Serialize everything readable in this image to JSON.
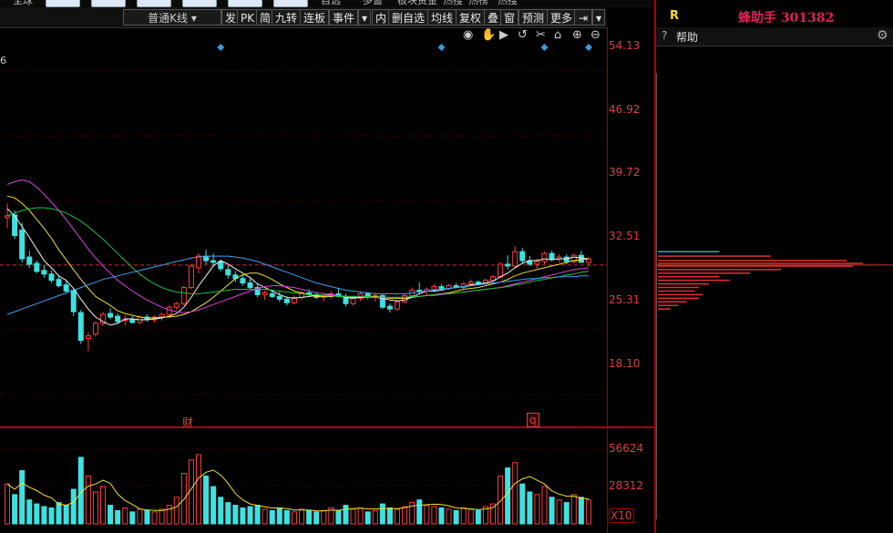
{
  "nav": {
    "items": [
      "全球",
      "自选",
      "多窗",
      "板块资金",
      "热搜",
      "热榜",
      "热搜"
    ]
  },
  "toolbar": {
    "kline_type": "普通K线",
    "buttons": [
      "发",
      "PK",
      "简",
      "九转",
      "连板",
      "事件",
      "内",
      "删自选",
      "均线",
      "复权",
      "叠",
      "窗",
      "预测",
      "更多"
    ]
  },
  "right_panel": {
    "label": "R",
    "title": "蜂助手 301382",
    "help_label": "帮助"
  },
  "left_edge_text": "6",
  "price_axis": {
    "ticks": [
      "54.13",
      "46.92",
      "39.72",
      "32.51",
      "25.31",
      "18.10"
    ]
  },
  "volume_axis": {
    "ticks": [
      "56624",
      "28312"
    ],
    "unit": "X10"
  },
  "markers": {
    "finance": "财",
    "q": "q"
  },
  "colors": {
    "up": "#ff3b3b",
    "down": "#3fe0e0",
    "ma5": "#f0f0f0",
    "ma10": "#f0e030",
    "ma20": "#e040e0",
    "ma30": "#20c040",
    "ma60": "#40a0f0",
    "event": "#3a9ad8",
    "axis": "#d84040"
  },
  "chart_data": {
    "type": "candlestick",
    "x": [
      "1",
      "2",
      "3",
      "4",
      "5",
      "6",
      "7",
      "8",
      "9",
      "10",
      "11",
      "12",
      "13",
      "14",
      "15",
      "16",
      "17",
      "18",
      "19",
      "20",
      "21",
      "22",
      "23",
      "24",
      "25",
      "26",
      "27",
      "28",
      "29",
      "30",
      "31",
      "32",
      "33",
      "34",
      "35",
      "36",
      "37",
      "38",
      "39",
      "40",
      "41",
      "42",
      "43",
      "44",
      "45",
      "46",
      "47",
      "48",
      "49",
      "50",
      "51",
      "52",
      "53",
      "54",
      "55",
      "56",
      "57",
      "58",
      "59",
      "60",
      "61",
      "62",
      "63",
      "64",
      "65",
      "66",
      "67",
      "68",
      "69",
      "70",
      "71",
      "72",
      "73",
      "74",
      "75",
      "76",
      "77",
      "78",
      "79",
      "80"
    ],
    "ohlc": [
      [
        37.8,
        39.4,
        36.6,
        38.0
      ],
      [
        38.1,
        38.6,
        35.4,
        35.8
      ],
      [
        36.4,
        37.2,
        32.8,
        33.2
      ],
      [
        33.4,
        34.1,
        32.2,
        32.6
      ],
      [
        32.7,
        33.0,
        31.6,
        31.8
      ],
      [
        31.9,
        32.5,
        31.1,
        31.5
      ],
      [
        31.5,
        31.9,
        30.5,
        30.8
      ],
      [
        30.9,
        31.4,
        30.0,
        30.2
      ],
      [
        30.3,
        30.7,
        29.3,
        29.6
      ],
      [
        29.7,
        29.9,
        26.8,
        27.3
      ],
      [
        27.2,
        27.5,
        23.7,
        24.1
      ],
      [
        24.3,
        25.0,
        22.9,
        24.6
      ],
      [
        24.8,
        26.2,
        24.5,
        26.0
      ],
      [
        26.0,
        27.3,
        25.7,
        27.0
      ],
      [
        27.1,
        27.7,
        26.5,
        26.7
      ],
      [
        26.8,
        27.1,
        26.0,
        26.2
      ],
      [
        26.3,
        26.9,
        25.8,
        26.4
      ],
      [
        26.4,
        26.8,
        26.0,
        26.1
      ],
      [
        26.1,
        26.9,
        25.9,
        26.7
      ],
      [
        26.7,
        27.0,
        26.2,
        26.4
      ],
      [
        26.4,
        26.9,
        26.1,
        26.7
      ],
      [
        26.7,
        27.2,
        26.3,
        27.0
      ],
      [
        27.0,
        28.0,
        26.8,
        27.8
      ],
      [
        27.8,
        28.4,
        27.5,
        28.2
      ],
      [
        28.2,
        30.2,
        28.0,
        30.0
      ],
      [
        30.0,
        32.6,
        29.8,
        32.4
      ],
      [
        32.2,
        33.8,
        31.6,
        33.5
      ],
      [
        33.5,
        34.2,
        32.6,
        33.0
      ],
      [
        33.0,
        33.8,
        32.4,
        32.8
      ],
      [
        32.9,
        33.1,
        31.8,
        32.1
      ],
      [
        32.0,
        32.5,
        31.0,
        31.4
      ],
      [
        31.4,
        31.8,
        30.6,
        31.0
      ],
      [
        31.0,
        31.4,
        30.2,
        30.5
      ],
      [
        30.5,
        31.0,
        29.8,
        30.0
      ],
      [
        30.0,
        30.5,
        28.9,
        29.2
      ],
      [
        29.2,
        29.7,
        28.6,
        29.4
      ],
      [
        29.3,
        29.8,
        28.8,
        29.0
      ],
      [
        29.0,
        29.5,
        28.4,
        28.7
      ],
      [
        28.7,
        29.0,
        28.0,
        28.3
      ],
      [
        28.3,
        29.1,
        28.1,
        28.9
      ],
      [
        28.9,
        29.6,
        28.6,
        29.4
      ],
      [
        29.4,
        29.8,
        29.0,
        29.2
      ],
      [
        29.2,
        29.5,
        28.7,
        28.9
      ],
      [
        28.9,
        29.4,
        28.5,
        29.0
      ],
      [
        29.0,
        29.6,
        28.8,
        29.3
      ],
      [
        29.3,
        29.9,
        28.9,
        29.0
      ],
      [
        29.0,
        29.3,
        27.9,
        28.2
      ],
      [
        28.2,
        29.0,
        28.0,
        28.8
      ],
      [
        28.8,
        29.6,
        28.5,
        29.3
      ],
      [
        29.3,
        29.5,
        28.7,
        28.9
      ],
      [
        28.9,
        29.4,
        28.4,
        29.1
      ],
      [
        29.1,
        29.3,
        27.6,
        27.8
      ],
      [
        27.9,
        28.2,
        27.2,
        27.6
      ],
      [
        27.6,
        28.6,
        27.4,
        28.4
      ],
      [
        28.4,
        29.3,
        28.2,
        29.1
      ],
      [
        29.1,
        30.0,
        28.9,
        29.7
      ],
      [
        29.7,
        30.6,
        29.3,
        29.6
      ],
      [
        29.6,
        30.0,
        29.1,
        29.8
      ],
      [
        29.8,
        30.4,
        29.5,
        30.1
      ],
      [
        30.1,
        30.4,
        29.7,
        29.9
      ],
      [
        29.9,
        30.4,
        29.7,
        30.2
      ],
      [
        30.2,
        30.5,
        29.9,
        30.0
      ],
      [
        30.0,
        30.6,
        29.8,
        30.4
      ],
      [
        30.4,
        30.9,
        30.2,
        30.6
      ],
      [
        30.6,
        30.8,
        30.2,
        30.5
      ],
      [
        30.5,
        31.0,
        30.3,
        30.8
      ],
      [
        30.8,
        31.4,
        30.6,
        31.2
      ],
      [
        31.2,
        32.8,
        31.0,
        32.6
      ],
      [
        32.6,
        33.6,
        32.0,
        32.4
      ],
      [
        32.4,
        34.6,
        32.2,
        34.0
      ],
      [
        34.0,
        34.4,
        32.7,
        33.0
      ],
      [
        33.0,
        33.5,
        32.4,
        32.6
      ],
      [
        32.6,
        33.2,
        32.1,
        32.9
      ],
      [
        32.9,
        34.0,
        32.6,
        33.8
      ],
      [
        33.8,
        34.1,
        32.9,
        33.2
      ],
      [
        33.2,
        33.7,
        32.8,
        33.4
      ],
      [
        33.4,
        33.7,
        32.6,
        32.9
      ],
      [
        32.9,
        33.8,
        32.7,
        33.6
      ],
      [
        33.6,
        34.1,
        32.8,
        32.8
      ],
      [
        32.8,
        33.4,
        32.4,
        33.2
      ]
    ],
    "volume": [
      30000,
      22000,
      40000,
      18000,
      15000,
      13000,
      12000,
      16000,
      14000,
      26000,
      50000,
      36000,
      24000,
      28000,
      14000,
      10000,
      12000,
      9000,
      11000,
      10000,
      9000,
      11000,
      14000,
      20000,
      38000,
      48000,
      52000,
      36000,
      28000,
      20000,
      16000,
      14000,
      12000,
      13000,
      14000,
      11000,
      10000,
      12000,
      10000,
      9000,
      11000,
      10000,
      9000,
      10000,
      12000,
      10000,
      14000,
      11000,
      12000,
      9000,
      10000,
      15000,
      12000,
      11000,
      13000,
      16000,
      18000,
      14000,
      13000,
      12000,
      11000,
      10000,
      12000,
      11000,
      10000,
      13000,
      15000,
      36000,
      42000,
      46000,
      30000,
      24000,
      22000,
      28000,
      20000,
      18000,
      16000,
      22000,
      20000,
      18000
    ],
    "ma_lines": [
      {
        "name": "MA5",
        "values": [
          38.8,
          38.0,
          36.8,
          35.6,
          34.3,
          33.0,
          32.2,
          31.3,
          30.8,
          29.9,
          28.7,
          27.6,
          26.7,
          26.2,
          25.8,
          26.0,
          26.5,
          26.5,
          26.4,
          26.4,
          26.5,
          26.6,
          26.8,
          27.1,
          27.8,
          28.9,
          30.2,
          31.3,
          32.4,
          33.0,
          32.6,
          32.1,
          31.6,
          31.1,
          30.4,
          30.0,
          29.6,
          29.2,
          28.9,
          28.8,
          28.9,
          29.0,
          29.1,
          29.1,
          29.2,
          29.1,
          28.9,
          28.8,
          28.9,
          28.9,
          28.9,
          28.8,
          28.6,
          28.5,
          28.6,
          28.9,
          29.3,
          29.6,
          29.6,
          29.7,
          29.9,
          30.0,
          30.1,
          30.3,
          30.4,
          30.5,
          30.7,
          31.2,
          31.6,
          32.2,
          32.7,
          33.0,
          33.0,
          33.2,
          33.1,
          33.2,
          33.2,
          33.4,
          33.3,
          33.2
        ]
      },
      {
        "name": "MA10",
        "values": [
          40.2,
          40.0,
          39.4,
          38.6,
          37.6,
          36.6,
          35.5,
          34.2,
          33.1,
          32.0,
          30.9,
          29.9,
          29.0,
          28.5,
          28.0,
          27.4,
          27.1,
          26.9,
          26.7,
          26.6,
          26.6,
          26.7,
          26.7,
          26.8,
          27.0,
          27.3,
          27.8,
          28.3,
          28.9,
          29.6,
          30.3,
          31.0,
          31.4,
          31.6,
          31.6,
          31.3,
          30.9,
          30.4,
          30.0,
          29.6,
          29.4,
          29.2,
          29.0,
          29.0,
          29.0,
          29.1,
          29.0,
          28.9,
          29.0,
          29.0,
          29.0,
          28.9,
          28.8,
          28.8,
          28.8,
          28.9,
          29.0,
          29.1,
          29.2,
          29.3,
          29.4,
          29.6,
          29.8,
          29.9,
          30.0,
          30.2,
          30.4,
          30.6,
          30.9,
          31.3,
          31.6,
          31.8,
          32.0,
          32.2,
          32.4,
          32.6,
          32.8,
          33.0,
          33.1,
          33.2
        ]
      },
      {
        "name": "MA20",
        "values": [
          41.5,
          41.8,
          42.0,
          41.8,
          41.2,
          40.4,
          39.5,
          38.6,
          37.6,
          36.5,
          35.4,
          34.3,
          33.3,
          32.4,
          31.6,
          30.8,
          30.2,
          29.6,
          29.1,
          28.6,
          28.2,
          27.8,
          27.5,
          27.3,
          27.2,
          27.3,
          27.5,
          27.8,
          28.1,
          28.4,
          28.7,
          29.0,
          29.3,
          29.6,
          29.9,
          30.1,
          30.2,
          30.2,
          30.1,
          30.0,
          29.8,
          29.6,
          29.4,
          29.3,
          29.2,
          29.1,
          29.0,
          29.0,
          29.0,
          28.9,
          28.9,
          28.9,
          28.9,
          28.9,
          28.9,
          29.0,
          29.0,
          29.1,
          29.1,
          29.2,
          29.3,
          29.4,
          29.5,
          29.6,
          29.7,
          29.8,
          29.9,
          30.0,
          30.2,
          30.4,
          30.6,
          30.8,
          31.0,
          31.2,
          31.4,
          31.6,
          31.8,
          32.0,
          32.1,
          32.2
        ]
      },
      {
        "name": "MA30",
        "values": [
          38.0,
          38.3,
          38.6,
          38.8,
          38.9,
          38.9,
          38.8,
          38.6,
          38.3,
          37.9,
          37.4,
          36.8,
          36.1,
          35.4,
          34.6,
          33.8,
          33.0,
          32.2,
          31.5,
          30.9,
          30.4,
          30.0,
          29.7,
          29.5,
          29.4,
          29.3,
          29.3,
          29.4,
          29.5,
          29.6,
          29.7,
          29.8,
          29.8,
          29.8,
          29.8,
          29.8,
          29.7,
          29.6,
          29.5,
          29.4,
          29.3,
          29.2,
          29.2,
          29.1,
          29.1,
          29.0,
          29.0,
          29.0,
          29.0,
          29.0,
          28.9,
          28.9,
          28.9,
          28.9,
          28.9,
          29.0,
          29.0,
          29.1,
          29.2,
          29.3,
          29.3,
          29.4,
          29.5,
          29.6,
          29.7,
          29.8,
          29.9,
          30.0,
          30.1,
          30.3,
          30.4,
          30.6,
          30.8,
          30.9,
          31.1,
          31.2,
          31.4,
          31.5,
          31.7,
          31.8
        ]
      },
      {
        "name": "MA60",
        "values": [
          27.0,
          27.3,
          27.6,
          27.9,
          28.2,
          28.5,
          28.8,
          29.1,
          29.4,
          29.7,
          30.0,
          30.3,
          30.6,
          30.9,
          31.1,
          31.3,
          31.5,
          31.7,
          31.9,
          32.1,
          32.3,
          32.5,
          32.7,
          32.9,
          33.1,
          33.3,
          33.4,
          33.5,
          33.5,
          33.5,
          33.5,
          33.4,
          33.3,
          33.1,
          32.9,
          32.6,
          32.3,
          32.0,
          31.7,
          31.4,
          31.1,
          30.8,
          30.5,
          30.3,
          30.1,
          29.9,
          29.7,
          29.6,
          29.5,
          29.4,
          29.3,
          29.3,
          29.3,
          29.3,
          29.3,
          29.4,
          29.5,
          29.6,
          29.7,
          29.8,
          29.9,
          30.0,
          30.1,
          30.2,
          30.3,
          30.4,
          30.5,
          30.6,
          30.7,
          30.8,
          30.9,
          31.0,
          31.0,
          31.1,
          31.1,
          31.2,
          31.2,
          31.2,
          31.3,
          31.3
        ]
      }
    ],
    "y_range": [
      14.5,
      57.0
    ],
    "volume_range": [
      0,
      65000
    ],
    "current_price": 32.51,
    "price_ticks": [
      54.13,
      46.92,
      39.72,
      32.51,
      25.31,
      18.1
    ],
    "volume_ticks": [
      56624,
      28312
    ],
    "volume_profile": [
      {
        "price": 34.0,
        "vol": 0.3
      },
      {
        "price": 33.5,
        "vol": 0.55
      },
      {
        "price": 33.0,
        "vol": 0.92
      },
      {
        "price": 32.7,
        "vol": 1.0
      },
      {
        "price": 32.4,
        "vol": 0.95
      },
      {
        "price": 32.0,
        "vol": 0.6
      },
      {
        "price": 31.6,
        "vol": 0.45
      },
      {
        "price": 31.2,
        "vol": 0.3
      },
      {
        "price": 30.8,
        "vol": 0.35
      },
      {
        "price": 30.4,
        "vol": 0.25
      },
      {
        "price": 30.0,
        "vol": 0.2
      },
      {
        "price": 29.6,
        "vol": 0.18
      },
      {
        "price": 29.2,
        "vol": 0.22
      },
      {
        "price": 28.8,
        "vol": 0.2
      },
      {
        "price": 28.4,
        "vol": 0.14
      },
      {
        "price": 28.0,
        "vol": 0.1
      },
      {
        "price": 27.6,
        "vol": 0.06
      }
    ],
    "event_marker_index": [
      30,
      60,
      74,
      80
    ]
  }
}
